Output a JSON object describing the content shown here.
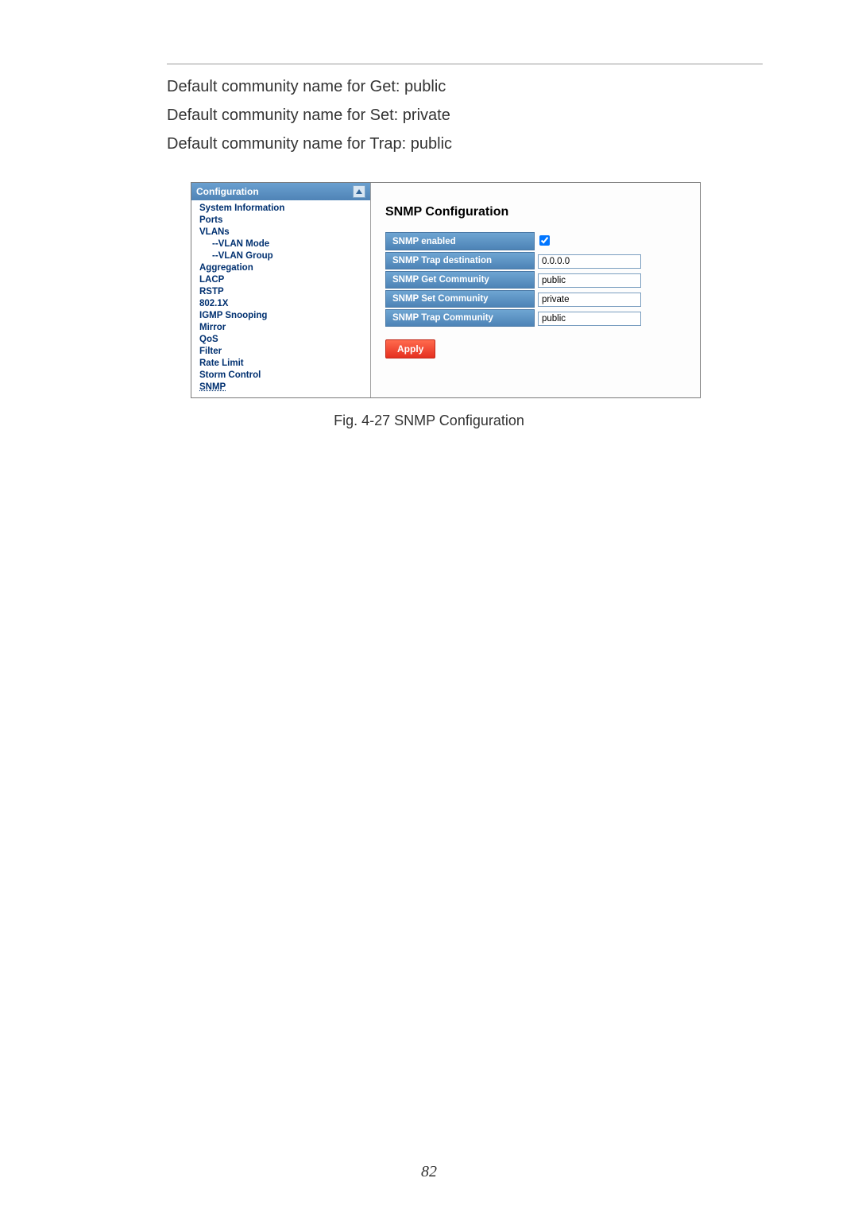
{
  "body_lines": [
    "Default community name for Get: public",
    "Default community name for Set: private",
    "Default community name for Trap: public"
  ],
  "caption": "Fig. 4-27 SNMP Configuration",
  "page_number": "82",
  "sidebar": {
    "header": "Configuration",
    "items": [
      {
        "label": "System Information",
        "type": "item"
      },
      {
        "label": "Ports",
        "type": "item"
      },
      {
        "label": "VLANs",
        "type": "item"
      },
      {
        "label": "VLAN Mode",
        "type": "sub"
      },
      {
        "label": "VLAN Group",
        "type": "sub"
      },
      {
        "label": "Aggregation",
        "type": "item"
      },
      {
        "label": "LACP",
        "type": "item"
      },
      {
        "label": "RSTP",
        "type": "item"
      },
      {
        "label": "802.1X",
        "type": "item"
      },
      {
        "label": "IGMP Snooping",
        "type": "item"
      },
      {
        "label": "Mirror",
        "type": "item"
      },
      {
        "label": "QoS",
        "type": "item"
      },
      {
        "label": "Filter",
        "type": "item"
      },
      {
        "label": "Rate Limit",
        "type": "item"
      },
      {
        "label": "Storm Control",
        "type": "item"
      },
      {
        "label": "SNMP",
        "type": "item",
        "selected": true
      }
    ]
  },
  "main": {
    "title": "SNMP Configuration",
    "rows": [
      {
        "label": "SNMP enabled",
        "kind": "checkbox",
        "checked": true
      },
      {
        "label": "SNMP Trap destination",
        "kind": "text",
        "value": "0.0.0.0"
      },
      {
        "label": "SNMP Get Community",
        "kind": "text",
        "value": "public"
      },
      {
        "label": "SNMP Set Community",
        "kind": "text",
        "value": "private"
      },
      {
        "label": "SNMP Trap Community",
        "kind": "text",
        "value": "public"
      }
    ],
    "apply_label": "Apply"
  }
}
